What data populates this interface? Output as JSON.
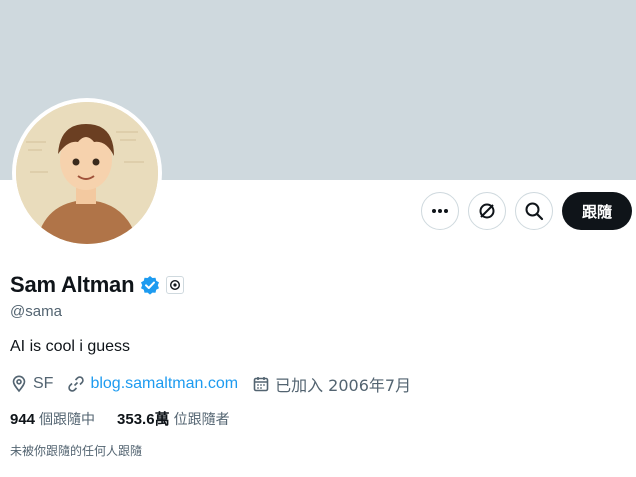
{
  "profile": {
    "display_name": "Sam Altman",
    "handle": "@sama",
    "bio": "AI is cool i guess",
    "location": "SF",
    "website": "blog.samaltman.com",
    "joined": "已加入 2006年7月"
  },
  "stats": {
    "following_count": "944",
    "following_label": "個跟隨中",
    "followers_count": "353.6萬",
    "followers_label": "位跟隨者"
  },
  "not_followed_text": "未被你跟隨的任何人跟隨",
  "actions": {
    "follow_label": "跟隨",
    "more_icon": "more-icon",
    "subscribe_icon": "grok-icon",
    "search_icon": "search-icon"
  },
  "colors": {
    "banner": "#cfd9de",
    "link": "#1d9bf0",
    "verified": "#1d9bf0",
    "follow_button": "#0f1419"
  }
}
